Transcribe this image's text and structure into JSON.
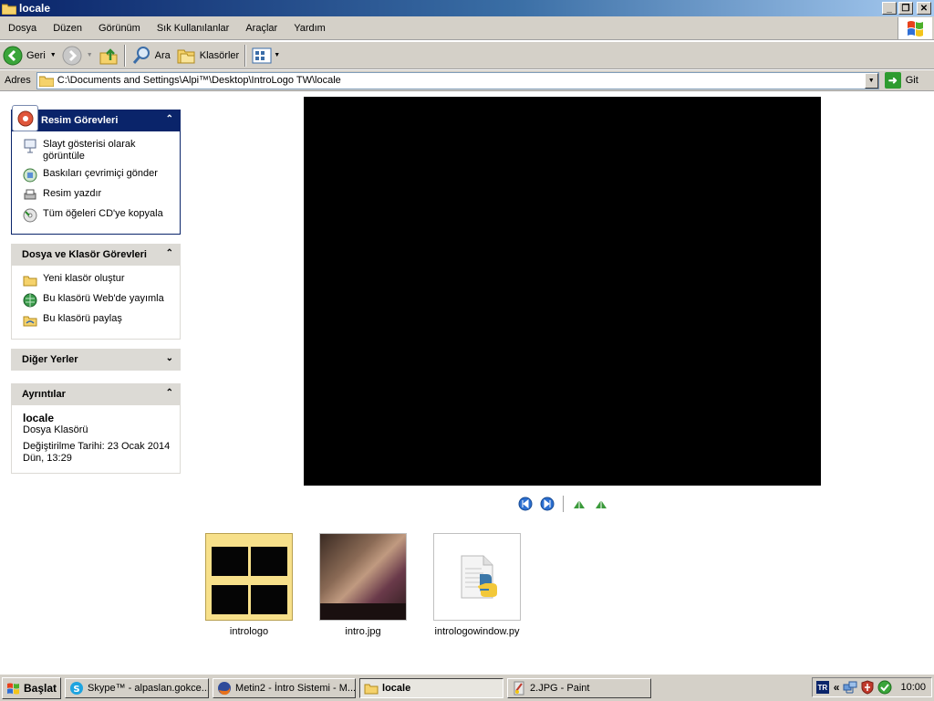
{
  "window": {
    "title": "locale"
  },
  "menu": {
    "items": [
      "Dosya",
      "Düzen",
      "Görünüm",
      "Sık Kullanılanlar",
      "Araçlar",
      "Yardım"
    ]
  },
  "toolbar": {
    "back_label": "Geri",
    "search_label": "Ara",
    "folders_label": "Klasörler"
  },
  "address": {
    "label": "Adres",
    "value": "C:\\Documents and Settings\\Alpi™\\Desktop\\IntroLogo TW\\locale",
    "go_label": "Git"
  },
  "panels": {
    "picture_tasks": {
      "title": "Resim Görevleri",
      "items": [
        {
          "label": "Slayt gösterisi olarak görüntüle",
          "icon": "slideshow-icon"
        },
        {
          "label": "Baskıları çevrimiçi gönder",
          "icon": "online-print-icon"
        },
        {
          "label": "Resim yazdır",
          "icon": "printer-icon"
        },
        {
          "label": "Tüm öğeleri CD'ye kopyala",
          "icon": "cd-copy-icon"
        }
      ]
    },
    "file_tasks": {
      "title": "Dosya ve Klasör Görevleri",
      "items": [
        {
          "label": "Yeni klasör oluştur",
          "icon": "new-folder-icon"
        },
        {
          "label": "Bu klasörü Web'de yayımla",
          "icon": "web-publish-icon"
        },
        {
          "label": "Bu klasörü paylaş",
          "icon": "share-folder-icon"
        }
      ]
    },
    "other_places": {
      "title": "Diğer Yerler"
    },
    "details": {
      "title": "Ayrıntılar",
      "name": "locale",
      "type": "Dosya Klasörü",
      "modified_line1": "Değiştirilme Tarihi: 23 Ocak 2014",
      "modified_line2": "Dün, 13:29"
    }
  },
  "files": [
    {
      "name": "intrologo",
      "kind": "folder"
    },
    {
      "name": "intro.jpg",
      "kind": "image"
    },
    {
      "name": "intrologowindow.py",
      "kind": "python"
    }
  ],
  "taskbar": {
    "start_label": "Başlat",
    "tasks": [
      {
        "label": "Skype™ - alpaslan.gokce...",
        "icon": "skype-icon",
        "active": false
      },
      {
        "label": "Metin2 - İntro Sistemi - M...",
        "icon": "firefox-icon",
        "active": false
      },
      {
        "label": "locale",
        "icon": "folder-icon",
        "active": true
      },
      {
        "label": "2.JPG - Paint",
        "icon": "paint-icon",
        "active": false
      }
    ],
    "lang": "TR",
    "clock": "10:00"
  },
  "colors": {
    "titlebar": "#0a246a",
    "panel_header": "#dcdad5",
    "chrome": "#d4d0c8"
  }
}
